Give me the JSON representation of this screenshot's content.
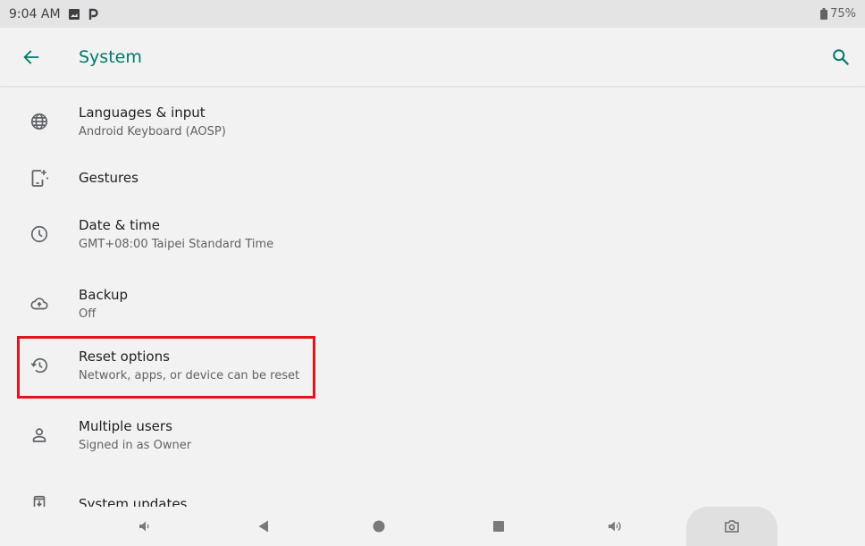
{
  "status_bar": {
    "time": "9:04 AM",
    "battery": "75%",
    "icons": [
      "image-notification-icon",
      "p-notification-icon",
      "battery-icon"
    ]
  },
  "app_bar": {
    "title": "System",
    "back_icon": "arrow-left-icon",
    "search_icon": "search-icon"
  },
  "items": [
    {
      "title": "Languages & input",
      "summary": "Android Keyboard (AOSP)",
      "icon": "globe-icon"
    },
    {
      "title": "Gestures",
      "summary": "",
      "icon": "gestures-phone-icon"
    },
    {
      "title": "Date & time",
      "summary": "GMT+08:00 Taipei Standard Time",
      "icon": "clock-icon"
    },
    {
      "title": "Backup",
      "summary": "Off",
      "icon": "cloud-upload-icon"
    },
    {
      "title": "Reset options",
      "summary": "Network, apps, or device can be reset",
      "icon": "history-icon"
    },
    {
      "title": "Multiple users",
      "summary": "Signed in as Owner",
      "icon": "person-icon"
    },
    {
      "title": "System updates",
      "summary": "",
      "icon": "system-update-icon"
    }
  ],
  "highlight_color": "#e3141b",
  "accent_color": "#00796b",
  "nav_bar": {
    "buttons": [
      "volume-down-icon",
      "back-triangle-icon",
      "home-circle-icon",
      "recents-square-icon",
      "volume-up-icon",
      "camera-icon"
    ]
  }
}
